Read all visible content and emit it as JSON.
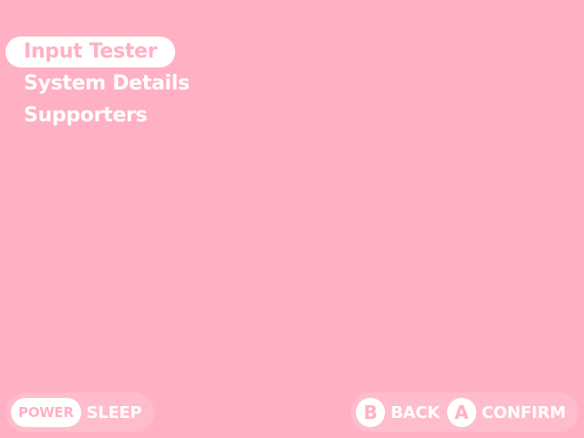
{
  "menu": {
    "items": [
      {
        "label": "Input Tester",
        "selected": true
      },
      {
        "label": "System Details",
        "selected": false
      },
      {
        "label": "Supporters",
        "selected": false
      }
    ]
  },
  "footer": {
    "left": {
      "button_label": "POWER",
      "action_label": "SLEEP"
    },
    "right": {
      "back_button": "B",
      "back_label": "BACK",
      "confirm_button": "A",
      "confirm_label": "CONFIRM"
    }
  },
  "colors": {
    "background": "#ffb0c2",
    "pill_background": "#ffbccb",
    "text": "#ffffff"
  }
}
